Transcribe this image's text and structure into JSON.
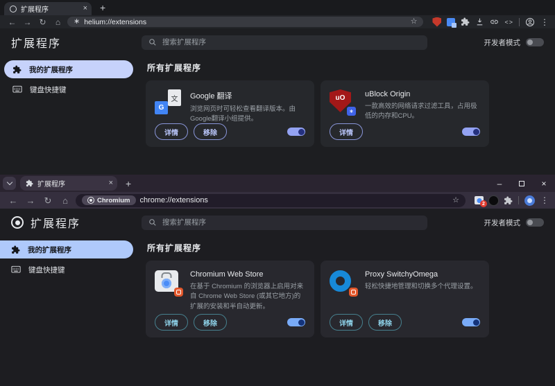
{
  "icons": {
    "back": "←",
    "forward": "→",
    "reload": "↻",
    "home": "⌂",
    "star": "☆",
    "menu": "⋮",
    "code": "<>",
    "new_tab": "+",
    "close": "×",
    "minimize": "–",
    "helium": "∗",
    "translate_char": "文",
    "g": "G",
    "ublock": "uO"
  },
  "top": {
    "tab_title": "扩展程序",
    "url": "helium://extensions",
    "page": {
      "title": "扩展程序",
      "search_placeholder": "搜索扩展程序",
      "dev_mode": "开发者模式",
      "sidebar": {
        "my_extensions": "我的扩展程序",
        "shortcuts": "键盘快捷键"
      },
      "section": "所有扩展程序",
      "cards": [
        {
          "name": "Google 翻译",
          "desc": "浏览网页时可轻松查看翻译版本。由Google翻译小组提供。",
          "details": "详情",
          "remove": "移除",
          "enabled": true
        },
        {
          "name": "uBlock Origin",
          "desc": "一款高效的网络请求过滤工具，占用极低的内存和CPU。",
          "details": "详情",
          "enabled": true
        }
      ]
    }
  },
  "bottom": {
    "tab_title": "扩展程序",
    "url_chip": "Chromium",
    "url": "chrome://extensions",
    "toolbar_badge": "2",
    "page": {
      "title": "扩展程序",
      "search_placeholder": "搜索扩展程序",
      "dev_mode": "开发者模式",
      "sidebar": {
        "my_extensions": "我的扩展程序",
        "shortcuts": "键盘快捷键"
      },
      "section": "所有扩展程序",
      "cards": [
        {
          "name": "Chromium Web Store",
          "desc": "在基于 Chromium 的浏览器上启用对来自 Chrome Web Store (或其它地方)的扩展的安装和半自动更新。",
          "details": "详情",
          "remove": "移除",
          "enabled": true
        },
        {
          "name": "Proxy SwitchyOmega",
          "desc": "轻松快捷地管理和切换多个代理设置。",
          "details": "详情",
          "remove": "移除",
          "enabled": true
        }
      ]
    }
  }
}
